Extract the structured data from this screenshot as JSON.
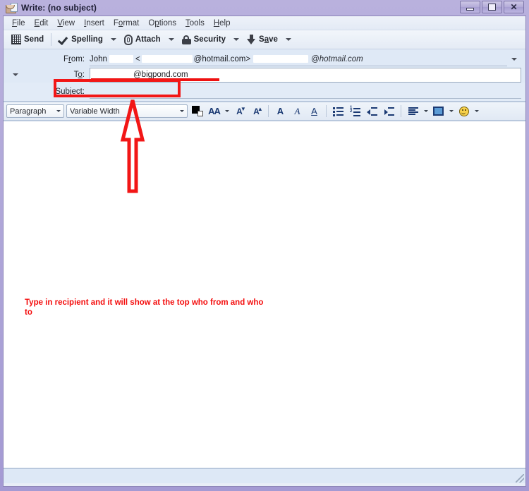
{
  "window": {
    "title": "Write: (no subject)",
    "icon": "compose-envelope-icon",
    "buttons": {
      "minimize": "–",
      "maximize": "□",
      "close": "✕"
    }
  },
  "menubar": {
    "items": [
      {
        "label": "File",
        "accesskey": "F"
      },
      {
        "label": "Edit",
        "accesskey": "E"
      },
      {
        "label": "View",
        "accesskey": "V"
      },
      {
        "label": "Insert",
        "accesskey": "I"
      },
      {
        "label": "Format",
        "accesskey": "o"
      },
      {
        "label": "Options",
        "accesskey": "p"
      },
      {
        "label": "Tools",
        "accesskey": "T"
      },
      {
        "label": "Help",
        "accesskey": "H"
      }
    ]
  },
  "toolbar": {
    "send_label": "Send",
    "spelling_label": "Spelling",
    "attach_label": "Attach",
    "security_label": "Security",
    "save_label": "Save"
  },
  "headers": {
    "from_label": "From:",
    "from_name": "John",
    "from_address_suffix": "@hotmail.com>",
    "from_identity_suffix": "@hotmail.com",
    "to_label": "To:",
    "to_address_suffix": "@bigpond.com",
    "subject_label": "Subject:",
    "subject_value": ""
  },
  "formatbar": {
    "paragraph_value": "Paragraph",
    "font_value": "Variable Width",
    "buttons": [
      "text-color-swatch",
      "font-size-menu",
      "decrease-font-size",
      "increase-font-size",
      "bold",
      "italic",
      "underline",
      "bulleted-list",
      "numbered-list",
      "outdent",
      "indent",
      "align-menu",
      "insert-image-menu",
      "insert-smiley-menu"
    ]
  },
  "annotation": {
    "text": "Type in recipient and it will show at the top who from and who to",
    "color": "#f40d0d",
    "arrow": "up-arrow-outline"
  },
  "body": {
    "content": ""
  },
  "statusbar": {
    "text": ""
  },
  "colors": {
    "title_gradient_top": "#b9b1dd",
    "title_gradient_bottom": "#a49ad3",
    "header_bg": "#dfe9f6",
    "body_bg": "#ffffff",
    "annotation_red": "#f40d0d",
    "icon_blue": "#1b3a73"
  }
}
